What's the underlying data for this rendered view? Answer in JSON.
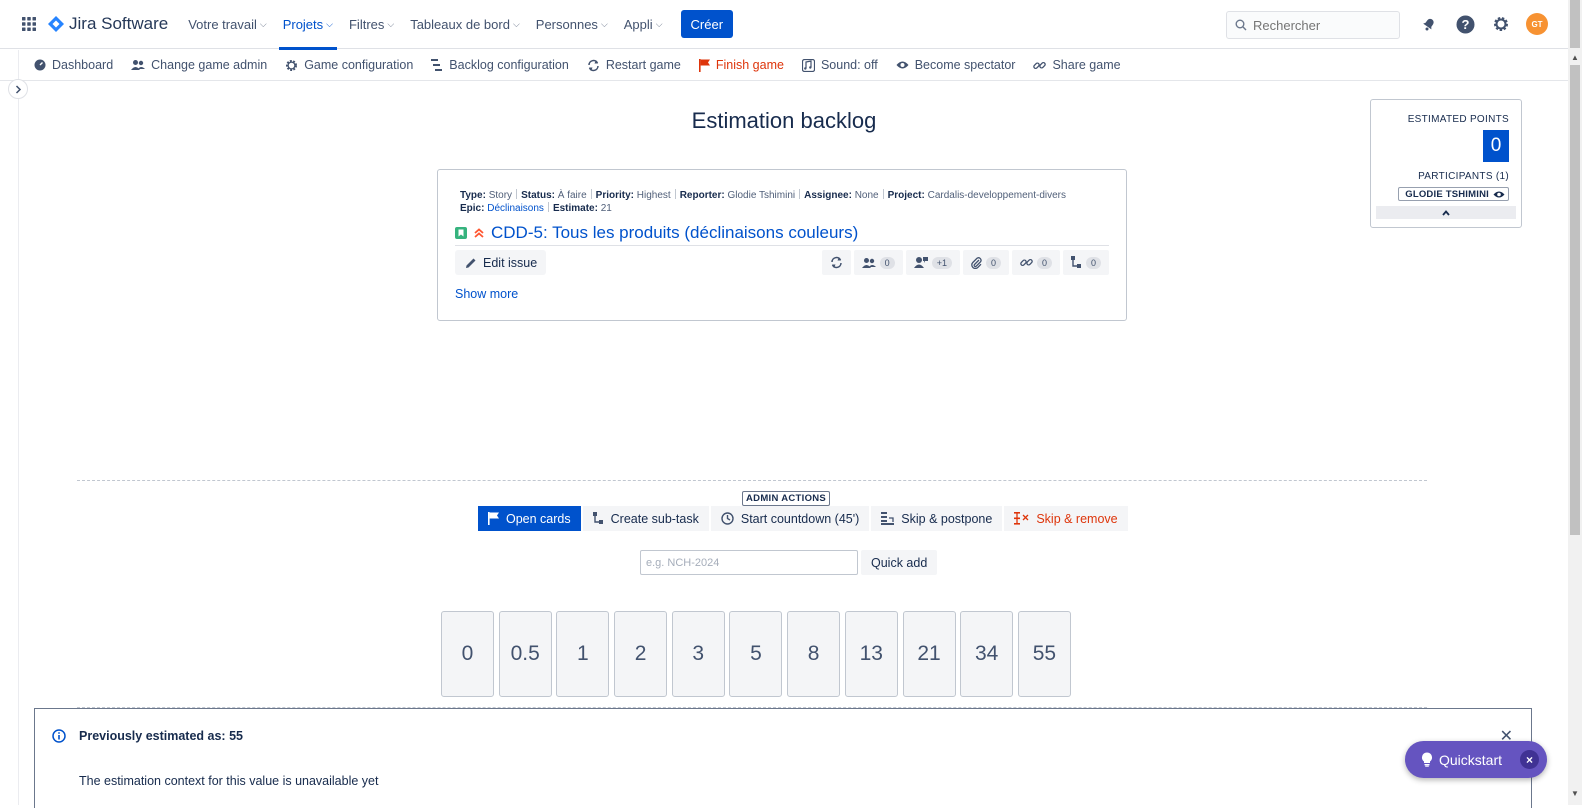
{
  "app": {
    "name": "Jira Software"
  },
  "nav": {
    "items": [
      {
        "label": "Votre travail",
        "active": false
      },
      {
        "label": "Projets",
        "active": true
      },
      {
        "label": "Filtres",
        "active": false
      },
      {
        "label": "Tableaux de bord",
        "active": false
      },
      {
        "label": "Personnes",
        "active": false
      },
      {
        "label": "Appli",
        "active": false
      }
    ],
    "create_label": "Créer",
    "search_placeholder": "Rechercher",
    "avatar_initials": "GT"
  },
  "gamebar": {
    "items": [
      {
        "label": "Dashboard",
        "icon": "dashboard-icon"
      },
      {
        "label": "Change game admin",
        "icon": "users-icon"
      },
      {
        "label": "Game configuration",
        "icon": "gear-icon"
      },
      {
        "label": "Backlog configuration",
        "icon": "backlog-icon"
      },
      {
        "label": "Restart game",
        "icon": "refresh-icon"
      },
      {
        "label": "Finish game",
        "icon": "flag-icon"
      },
      {
        "label": "Sound: off",
        "icon": "sound-icon"
      },
      {
        "label": "Become spectator",
        "icon": "eye-icon"
      },
      {
        "label": "Share game",
        "icon": "link-icon"
      }
    ]
  },
  "page": {
    "title": "Estimation backlog"
  },
  "issue": {
    "type_label": "Type:",
    "type": "Story",
    "status_label": "Status:",
    "status": "À faire",
    "priority_label": "Priority:",
    "priority": "Highest",
    "reporter_label": "Reporter:",
    "reporter": "Glodie Tshimini",
    "assignee_label": "Assignee:",
    "assignee": "None",
    "project_label": "Project:",
    "project": "Cardalis-developpement-divers",
    "epic_label": "Epic:",
    "epic": "Déclinaisons",
    "estimate_label": "Estimate:",
    "estimate": "21",
    "title": "CDD-5: Tous les produits (déclinaisons couleurs)",
    "edit_label": "Edit issue",
    "counters": {
      "voters": "0",
      "comments": "+1",
      "attachments": "0",
      "links": "0",
      "subtasks": "0"
    },
    "show_more": "Show more"
  },
  "points": {
    "label": "ESTIMATED POINTS",
    "value": "0",
    "participants_label": "PARTICIPANTS (1)",
    "participant": "GLODIE TSHIMINI"
  },
  "admin": {
    "label": "ADMIN ACTIONS",
    "actions": [
      {
        "label": "Open cards"
      },
      {
        "label": "Create sub-task"
      },
      {
        "label": "Start countdown (45')"
      },
      {
        "label": "Skip & postpone"
      },
      {
        "label": "Skip & remove"
      }
    ],
    "quickadd_placeholder": "e.g. NCH-2024",
    "quickadd_label": "Quick add"
  },
  "cards": [
    "0",
    "0.5",
    "1",
    "2",
    "3",
    "5",
    "8",
    "13",
    "21",
    "34",
    "55"
  ],
  "flag": {
    "title": "Previously estimated as: 55",
    "body": "The estimation context for this value is unavailable yet"
  },
  "quickstart": {
    "label": "Quickstart"
  }
}
